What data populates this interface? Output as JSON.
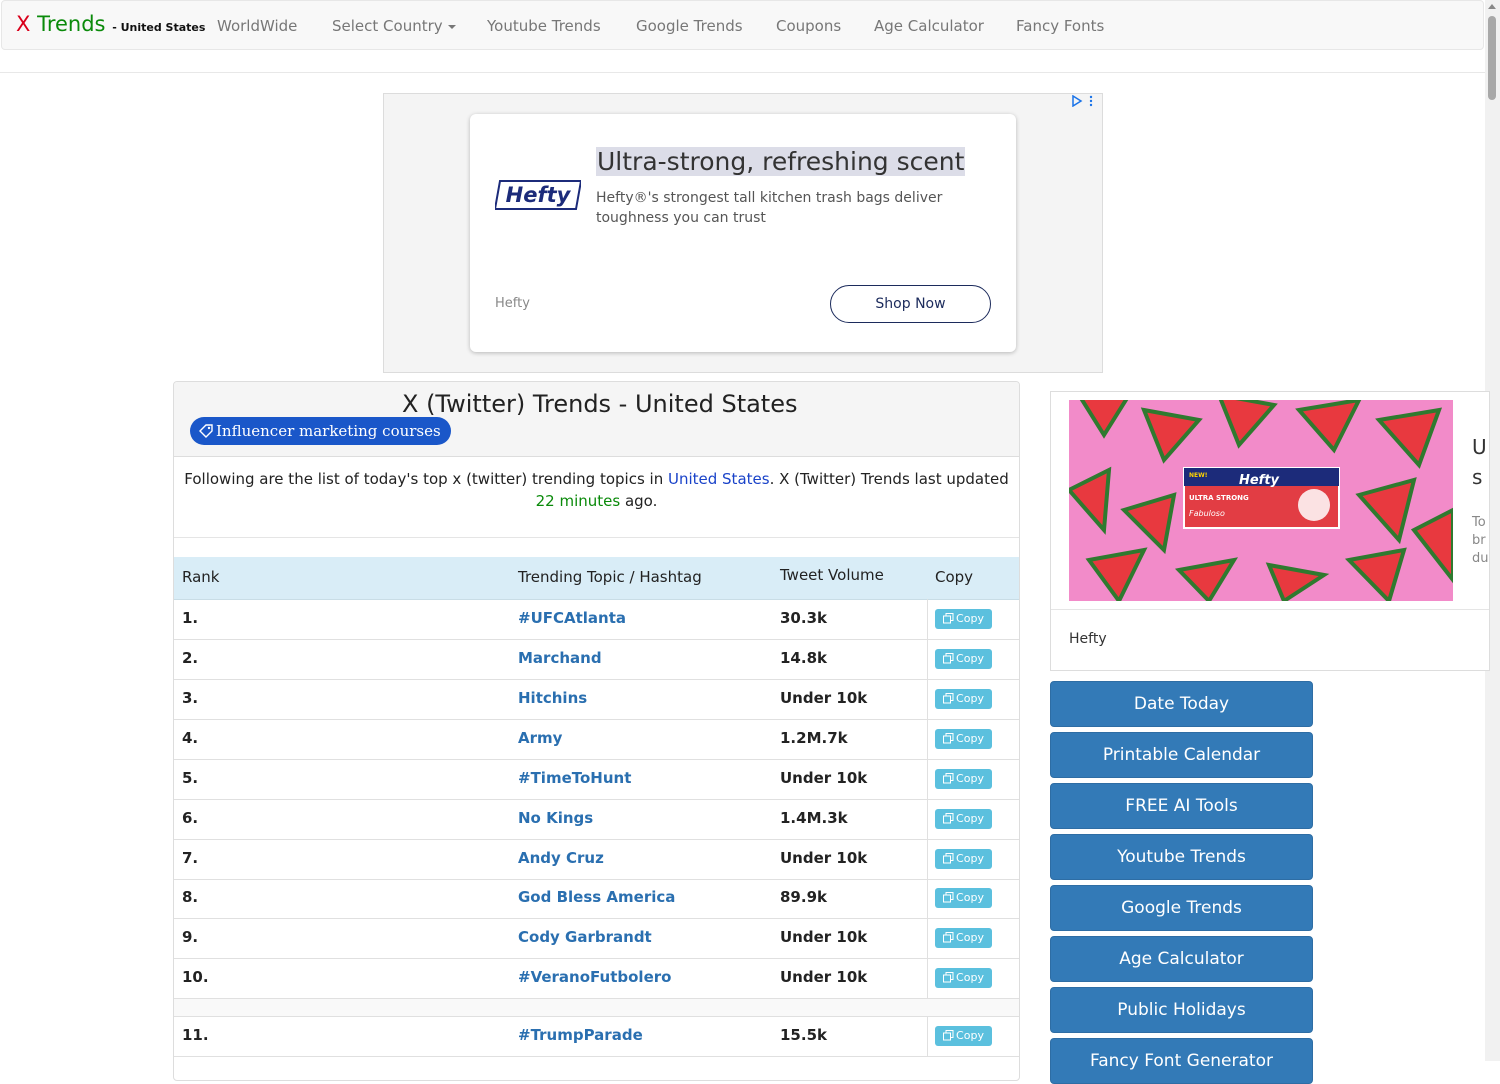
{
  "navbar": {
    "brand_x": "X",
    "brand_trends": "Trends",
    "brand_country": "- United States",
    "items": [
      "WorldWide",
      "Select Country",
      "Youtube Trends",
      "Google Trends",
      "Coupons",
      "Age Calculator",
      "Fancy Fonts"
    ]
  },
  "top_ad": {
    "headline": "Ultra-strong, refreshing scent",
    "body": "Hefty®'s strongest tall kitchen trash bags deliver toughness you can trust",
    "logo_text": "Hefty",
    "brand": "Hefty",
    "cta": "Shop Now"
  },
  "main": {
    "title": "X (Twitter) Trends - United States",
    "pill": "Influencer marketing courses",
    "intro_a": "Following are the list of today's top x (twitter) trending topics in ",
    "intro_country": "United States",
    "intro_b": ". X (Twitter) Trends last updated",
    "intro_time": "22 minutes",
    "intro_c": " ago.",
    "columns": [
      "Rank",
      "Trending Topic / Hashtag",
      "Tweet Volume",
      "Copy"
    ],
    "copy_label": "Copy",
    "rows": [
      {
        "rank": "1.",
        "topic": "#UFCAtlanta",
        "volume": "30.3k"
      },
      {
        "rank": "2.",
        "topic": "Marchand",
        "volume": "14.8k"
      },
      {
        "rank": "3.",
        "topic": "Hitchins",
        "volume": "Under 10k"
      },
      {
        "rank": "4.",
        "topic": "Army",
        "volume": "1.2M.7k"
      },
      {
        "rank": "5.",
        "topic": "#TimeToHunt",
        "volume": "Under 10k"
      },
      {
        "rank": "6.",
        "topic": "No Kings",
        "volume": "1.4M.3k"
      },
      {
        "rank": "7.",
        "topic": "Andy Cruz",
        "volume": "Under 10k"
      },
      {
        "rank": "8.",
        "topic": "God Bless America",
        "volume": "89.9k"
      },
      {
        "rank": "9.",
        "topic": "Cody Garbrandt",
        "volume": "Under 10k"
      },
      {
        "rank": "10.",
        "topic": "#VeranoFutbolero",
        "volume": "Under 10k"
      },
      {
        "rank": "11.",
        "topic": "#TrumpParade",
        "volume": "15.5k"
      }
    ]
  },
  "side_ad": {
    "brand": "Hefty",
    "pack_brand": "Hefty",
    "pack_line1": "ULTRA STRONG",
    "pack_line2": "Fabuloso",
    "pack_badge": "NEW!",
    "cut_title_1": "U",
    "cut_title_2": "s",
    "cut_body": [
      "To",
      "br",
      "du"
    ]
  },
  "sidebar_buttons": [
    "Date Today",
    "Printable Calendar",
    "FREE AI Tools",
    "Youtube Trends",
    "Google Trends",
    "Age Calculator",
    "Public Holidays",
    "Fancy Font Generator"
  ],
  "colors": {
    "brand_red": "#d9001b",
    "brand_green": "#0a8a0a",
    "link_blue": "#2a6fb0",
    "button_blue": "#337ab7",
    "copy_button": "#5bc0de",
    "table_header": "#d9edf7"
  }
}
